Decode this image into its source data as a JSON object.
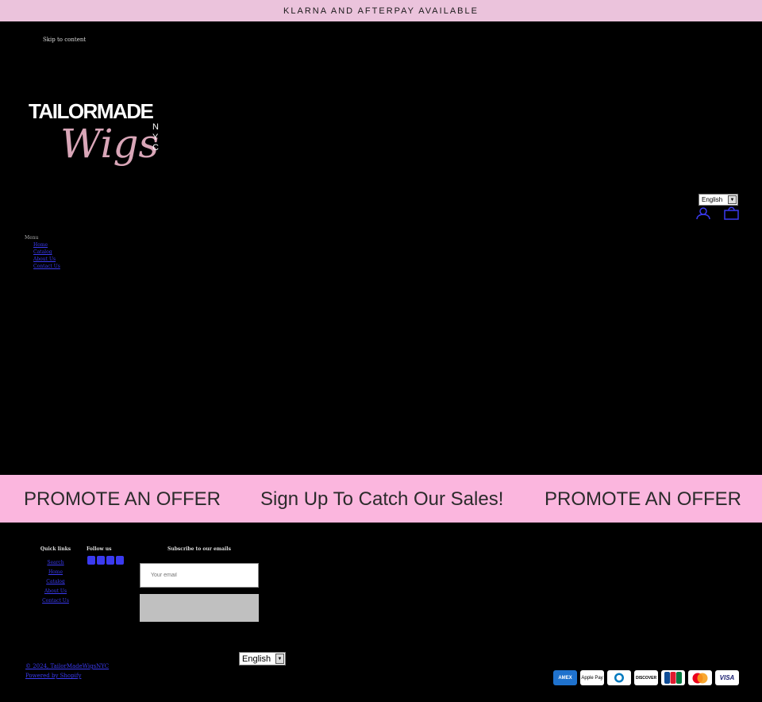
{
  "announcement": "KLARNA AND AFTERPAY AVAILABLE",
  "skip_link": "Skip to content",
  "logo": {
    "line1": "TAILORMADE",
    "line2": "Wigs",
    "line3": "NYC"
  },
  "header": {
    "language": "English",
    "account_icon": "user-icon",
    "cart_icon": "bag-icon"
  },
  "nav": {
    "heading": "Menu",
    "items": [
      {
        "label": "Home"
      },
      {
        "label": "Catalog"
      },
      {
        "label": "About Us"
      },
      {
        "label": "Contact Us"
      }
    ]
  },
  "marquee": [
    "PROMOTE AN OFFER",
    "Sign Up To Catch Our Sales!",
    "PROMOTE AN OFFER"
  ],
  "footer": {
    "links_heading": "Quick links",
    "links": [
      {
        "label": "Search"
      },
      {
        "label": "Home"
      },
      {
        "label": "Catalog"
      },
      {
        "label": "About Us"
      },
      {
        "label": "Contact Us"
      }
    ],
    "social_heading": "Follow us",
    "social_icons": [
      "facebook-icon",
      "instagram-icon",
      "tiktok-icon",
      "youtube-icon"
    ],
    "newsletter_heading": "Subscribe to our emails",
    "email_placeholder": "Your email",
    "language": "English",
    "copyright": "© 2024, TailorMadeWigsNYC",
    "powered_by": "Powered by Shopify",
    "payments": [
      "AMEX",
      "Apple Pay",
      "Diners",
      "DISCOVER",
      "JCB",
      "Mastercard",
      "VISA"
    ]
  },
  "colors": {
    "announcement_bg": "#ebc3dc",
    "marquee_bg": "#fbb6de",
    "page_bg": "#000000",
    "link": "#3a3af0"
  }
}
